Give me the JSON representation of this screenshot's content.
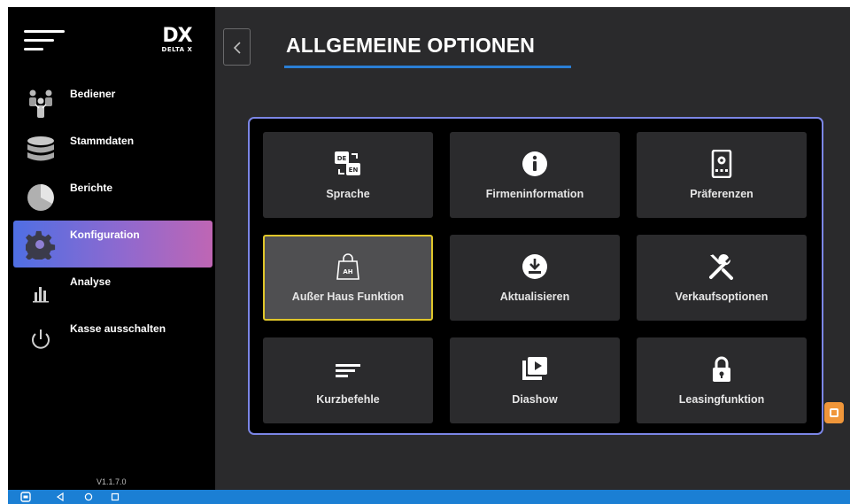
{
  "app": {
    "logo_mark": "DX",
    "logo_sub": "DELTA X",
    "version": "V1.1.7.0"
  },
  "sidebar": {
    "items": [
      {
        "label": "Bediener",
        "icon": "users-icon"
      },
      {
        "label": "Stammdaten",
        "icon": "database-icon"
      },
      {
        "label": "Berichte",
        "icon": "pie-chart-icon"
      },
      {
        "label": "Konfiguration",
        "icon": "gear-icon",
        "active": true
      },
      {
        "label": "Analyse",
        "icon": "bar-chart-icon"
      },
      {
        "label": "Kasse ausschalten",
        "icon": "power-icon"
      }
    ]
  },
  "header": {
    "title": "ALLGEMEINE OPTIONEN"
  },
  "tiles": [
    {
      "label": "Sprache",
      "icon": "translate-de-en-icon"
    },
    {
      "label": "Firmeninformation",
      "icon": "info-icon"
    },
    {
      "label": "Präferenzen",
      "icon": "device-settings-icon"
    },
    {
      "label": "Außer Haus Funktion",
      "icon": "takeaway-bag-icon",
      "selected": true
    },
    {
      "label": "Aktualisieren",
      "icon": "download-icon"
    },
    {
      "label": "Verkaufsoptionen",
      "icon": "tools-icon"
    },
    {
      "label": "Kurzbefehle",
      "icon": "short-text-icon"
    },
    {
      "label": "Diashow",
      "icon": "slideshow-icon"
    },
    {
      "label": "Leasingfunktion",
      "icon": "lock-icon"
    }
  ],
  "tile_icon_texts": {
    "de": "DE",
    "en": "EN",
    "ah": "AH"
  },
  "colors": {
    "accent": "#2a7fd6",
    "active_gradient_start": "#4f6fe3",
    "active_gradient_end": "#bf66b4",
    "selected_border": "#e0c62a",
    "panel_border": "#7b86e6",
    "badge": "#f0963a"
  }
}
